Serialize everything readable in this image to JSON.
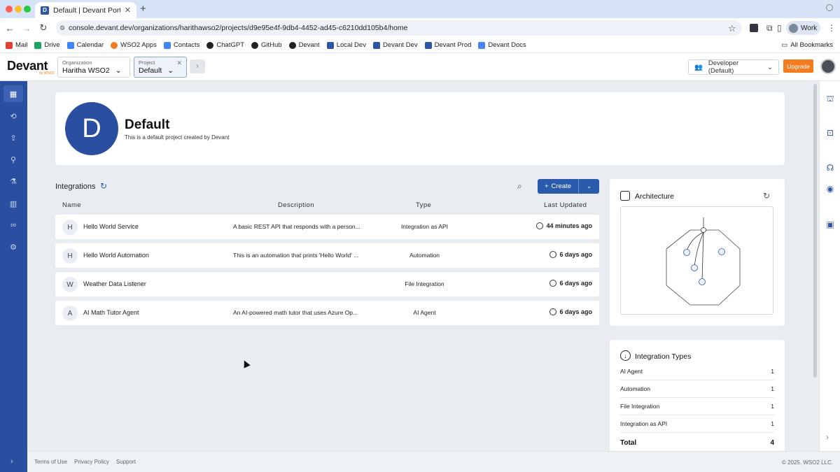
{
  "browser": {
    "tab_title": "Default | Devant Portal",
    "tab_favicon": "D",
    "url": "console.devant.dev/organizations/harithawso2/projects/d9e95e4f-9db4-4452-ad45-c6210dd105b4/home",
    "profile_label": "Work",
    "bookmarks": [
      "Mail",
      "Drive",
      "Calendar",
      "WSO2 Apps",
      "Contacts",
      "ChatGPT",
      "GitHub",
      "Devant",
      "Local Dev",
      "Devant Dev",
      "Devant Prod",
      "Devant Docs"
    ],
    "all_bookmarks": "All Bookmarks"
  },
  "header": {
    "logo": "Devant",
    "logo_sub": "by WSO2",
    "org_label": "Organization",
    "org_value": "Haritha WSO2",
    "project_label": "Project",
    "project_value": "Default",
    "role": "Developer (Default)",
    "upgrade": "Upgrade"
  },
  "project": {
    "initial": "D",
    "name": "Default",
    "description": "This is a default project created by Devant"
  },
  "integrations": {
    "title": "Integrations",
    "create_label": "Create",
    "columns": [
      "Name",
      "Description",
      "Type",
      "Last Updated"
    ],
    "rows": [
      {
        "initial": "H",
        "name": "Hello World Service",
        "description": "A basic REST API that responds with a person...",
        "type": "Integration as API",
        "updated": "44 minutes ago"
      },
      {
        "initial": "H",
        "name": "Hello World Automation",
        "description": "This is an automation that prints 'Hello World' ...",
        "type": "Automation",
        "updated": "6 days ago"
      },
      {
        "initial": "W",
        "name": "Weather Data Listener",
        "description": "",
        "type": "File Integration",
        "updated": "6 days ago"
      },
      {
        "initial": "A",
        "name": "AI Math Tutor Agent",
        "description": "An AI-powered math tutor that uses Azure Op...",
        "type": "AI Agent",
        "updated": "6 days ago"
      }
    ]
  },
  "architecture": {
    "title": "Architecture"
  },
  "integration_types": {
    "title": "Integration Types",
    "rows": [
      {
        "label": "AI Agent",
        "count": "1"
      },
      {
        "label": "Automation",
        "count": "1"
      },
      {
        "label": "File Integration",
        "count": "1"
      },
      {
        "label": "Integration as API",
        "count": "1"
      }
    ],
    "total_label": "Total",
    "total_value": "4"
  },
  "footer": {
    "links": [
      "Terms of Use",
      "Privacy Policy",
      "Support"
    ],
    "copyright": "© 2025, WSO2 LLC."
  },
  "colors": {
    "brand": "#2a4fa0",
    "accent": "#f47b20",
    "create_button": "#2a5aab"
  }
}
